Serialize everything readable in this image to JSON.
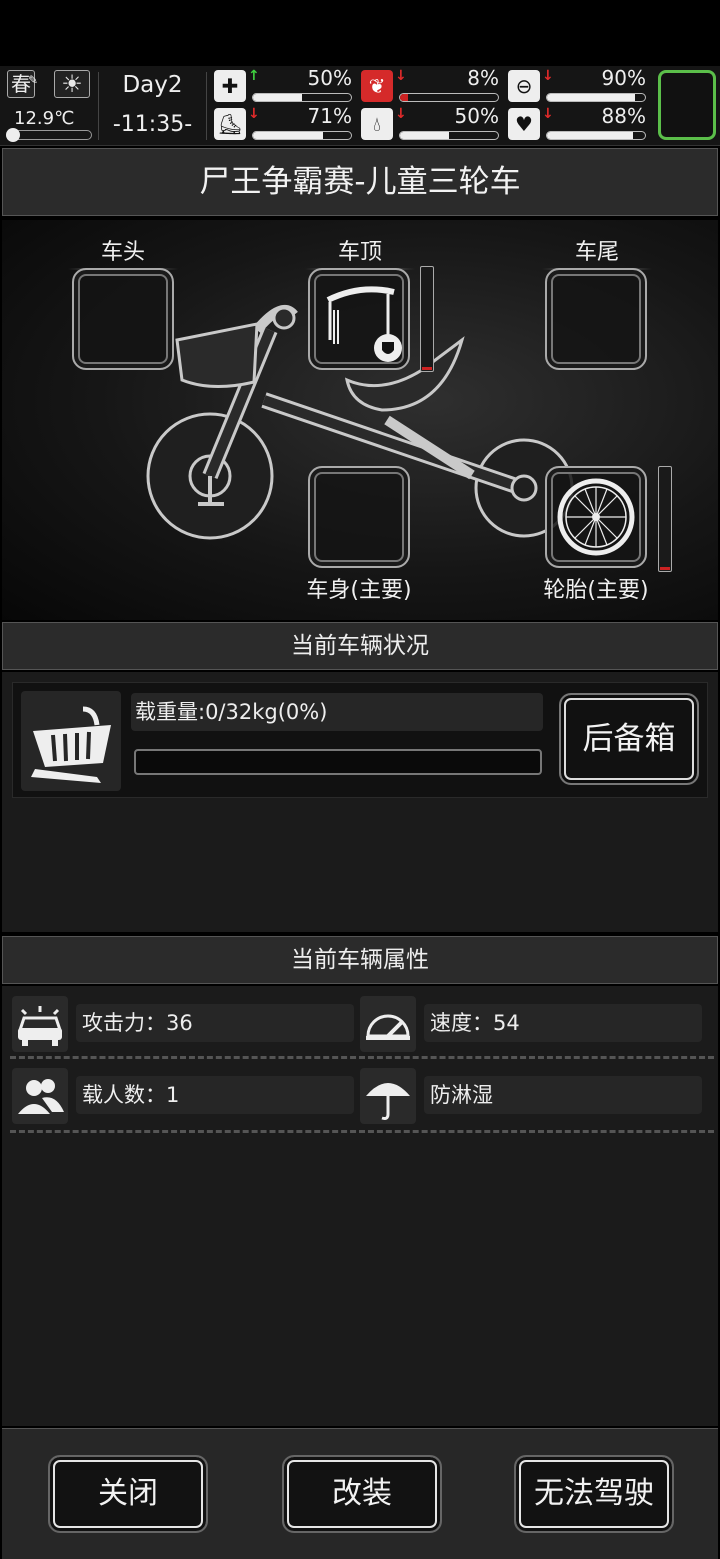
{
  "status": {
    "season": "春",
    "temperature": "12.9℃",
    "day": "Day2",
    "time": "-11:35-",
    "stats": [
      {
        "name": "health",
        "icon": "first-aid-icon",
        "trend": "up",
        "value": "50%",
        "level": 0.5
      },
      {
        "name": "hunger",
        "icon": "stomach-icon",
        "trend": "down",
        "value": "8%",
        "level": 0.08
      },
      {
        "name": "energy",
        "icon": "pill-icon",
        "trend": "down",
        "value": "90%",
        "level": 0.9
      },
      {
        "name": "stamina",
        "icon": "boot-icon",
        "trend": "down",
        "value": "71%",
        "level": 0.71
      },
      {
        "name": "thirst",
        "icon": "water-drop-icon",
        "trend": "down",
        "value": "50%",
        "level": 0.5
      },
      {
        "name": "mood",
        "icon": "heart-icon",
        "trend": "down",
        "value": "88%",
        "level": 0.88
      }
    ],
    "colors": {
      "up": "#3fcf3f",
      "down": "#e02a2a",
      "slot_border": "#5bbf4a"
    }
  },
  "title": "尸王争霸赛-儿童三轮车",
  "slots": {
    "head": "车头",
    "roof": "车顶",
    "tail": "车尾",
    "body": "车身(主要)",
    "tire": "轮胎(主要)"
  },
  "vehicle_status": {
    "header": "当前车辆状况",
    "load_text": "载重量:0/32kg(0%)",
    "load_level": 0,
    "trunk_button": "后备箱"
  },
  "attributes": {
    "header": "当前车辆属性",
    "items": [
      {
        "icon": "car-icon",
        "text": "攻击力：36"
      },
      {
        "icon": "speedometer-icon",
        "text": "速度：54"
      },
      {
        "icon": "people-icon",
        "text": "载人数：1"
      },
      {
        "icon": "umbrella-icon",
        "text": "防淋湿"
      }
    ]
  },
  "buttons": {
    "close": "关闭",
    "modify": "改装",
    "drive": "无法驾驶"
  }
}
